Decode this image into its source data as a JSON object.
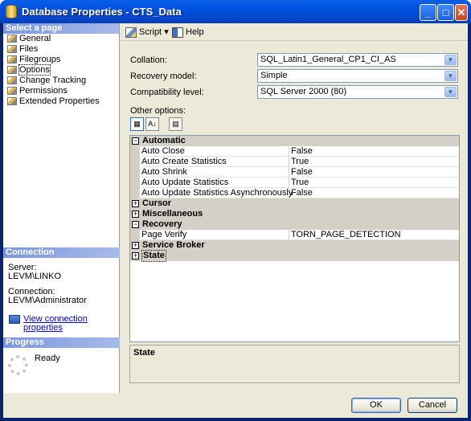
{
  "window": {
    "title": "Database Properties - CTS_Data",
    "minimize": "_",
    "maximize": "□",
    "close": "✕"
  },
  "sidebar": {
    "header": "Select a page",
    "items": [
      {
        "label": "General"
      },
      {
        "label": "Files"
      },
      {
        "label": "Filegroups"
      },
      {
        "label": "Options",
        "selected": true
      },
      {
        "label": "Change Tracking"
      },
      {
        "label": "Permissions"
      },
      {
        "label": "Extended Properties"
      }
    ],
    "connection": {
      "header": "Connection",
      "server_label": "Server:",
      "server_value": "LEVM\\LINKO",
      "connection_label": "Connection:",
      "connection_value": "LEVM\\Administrator",
      "link": "View connection properties"
    },
    "progress": {
      "header": "Progress",
      "status": "Ready"
    }
  },
  "toolbar": {
    "script": "Script",
    "script_arrow": "▾",
    "help": "Help"
  },
  "fields": {
    "collation_label": "Collation:",
    "collation_value": "SQL_Latin1_General_CP1_CI_AS",
    "recovery_label": "Recovery model:",
    "recovery_value": "Simple",
    "compat_label": "Compatibility level:",
    "compat_value": "SQL Server 2000 (80)",
    "other_label": "Other options:"
  },
  "grid": {
    "automatic": "Automatic",
    "auto_close": "Auto Close",
    "auto_close_v": "False",
    "auto_create": "Auto Create Statistics",
    "auto_create_v": "True",
    "auto_shrink": "Auto Shrink",
    "auto_shrink_v": "False",
    "auto_update": "Auto Update Statistics",
    "auto_update_v": "True",
    "auto_update_async": "Auto Update Statistics Asynchronously",
    "auto_update_async_v": "False",
    "cursor": "Cursor",
    "misc": "Miscellaneous",
    "recovery": "Recovery",
    "page_verify": "Page Verify",
    "page_verify_v": "TORN_PAGE_DETECTION",
    "broker": "Service Broker",
    "state": "State"
  },
  "description": {
    "title": "State"
  },
  "buttons": {
    "ok": "OK",
    "cancel": "Cancel"
  },
  "colors": {
    "titlebar": "#0054e3",
    "section_header": "#7a96df",
    "dialog_bg": "#ece9d8"
  }
}
